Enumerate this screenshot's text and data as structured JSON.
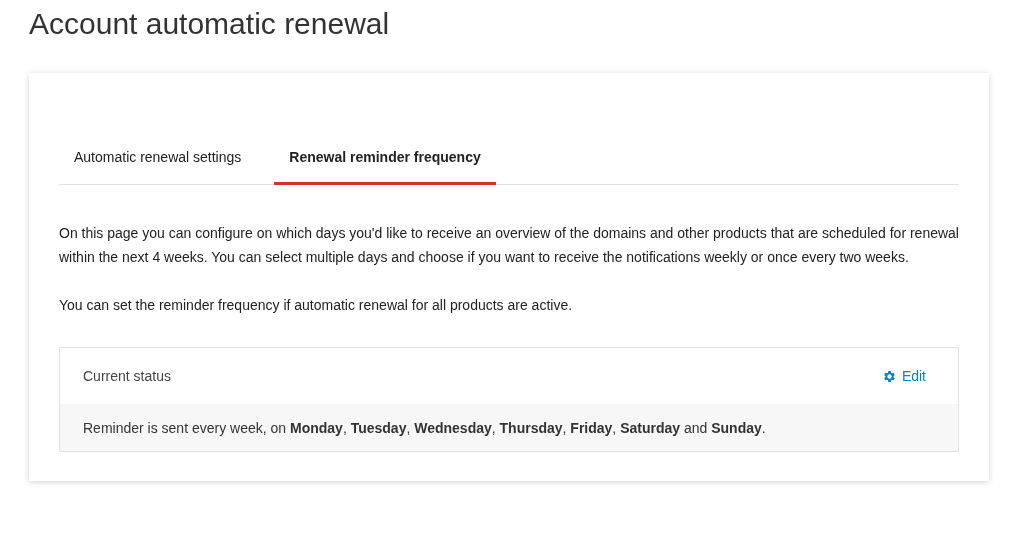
{
  "page_title": "Account automatic renewal",
  "tabs": [
    {
      "label": "Automatic renewal settings",
      "selected": false
    },
    {
      "label": "Renewal reminder frequency",
      "selected": true
    }
  ],
  "description": [
    "On this page you can configure on which days you'd like to receive an overview of the domains and other products that are scheduled for renewal within the next 4 weeks. You can select multiple days and choose if you want to receive the notifications weekly or once every two weeks.",
    "You can set the reminder frequency if automatic renewal for all products are active."
  ],
  "status_panel": {
    "title": "Current status",
    "edit_label": "Edit",
    "summary": "Reminder is sent every week, on **Monday**, **Tuesday**, **Wednesday**, **Thursday**, **Friday**, **Saturday** and **Sunday**."
  }
}
